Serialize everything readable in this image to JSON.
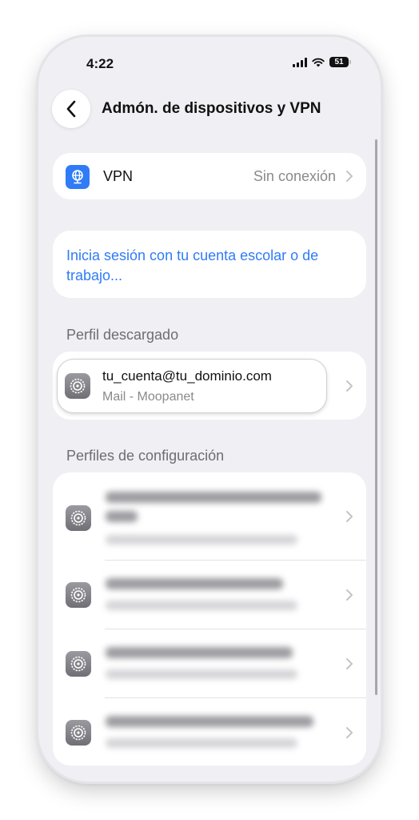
{
  "status_bar": {
    "time": "4:22",
    "battery": "51"
  },
  "nav": {
    "title": "Admón. de dispositivos y VPN"
  },
  "vpn": {
    "label": "VPN",
    "status": "Sin conexión"
  },
  "signin": {
    "link": "Inicia sesión con tu cuenta escolar o de trabajo..."
  },
  "downloaded": {
    "header": "Perfil descargado",
    "profile": {
      "title": "tu_cuenta@tu_dominio.com",
      "subtitle": "Mail - Moopanet"
    }
  },
  "config": {
    "header": "Perfiles de configuración"
  },
  "colors": {
    "accent": "#2f7cf6",
    "background": "#efeff4",
    "secondary_text": "#8a8a8e"
  }
}
